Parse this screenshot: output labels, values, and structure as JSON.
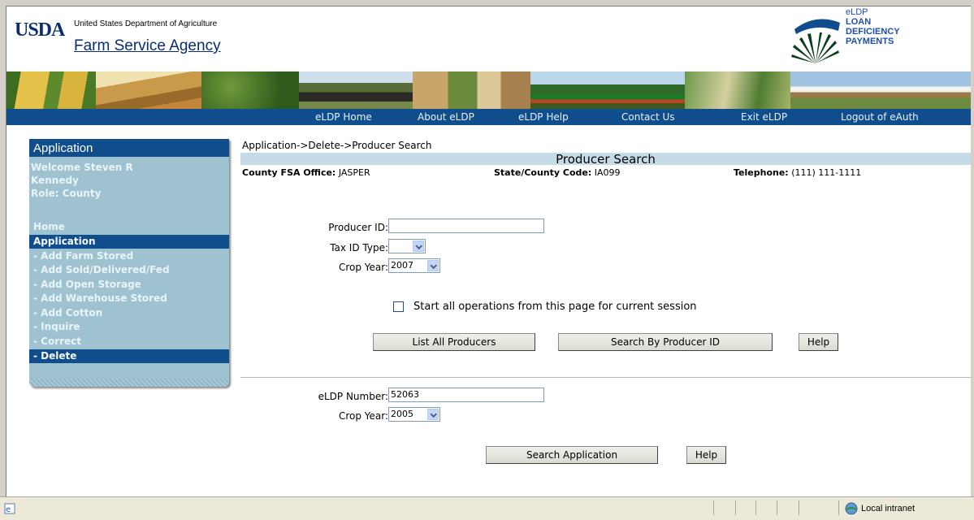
{
  "header": {
    "usda_logo": "USDA",
    "department": "United States Department of Agriculture",
    "agency": "Farm Service Agency",
    "eldp_logo": {
      "title": "eLDP",
      "line1": "LOAN",
      "line2": "DEFICIENCY",
      "line3": "PAYMENTS"
    }
  },
  "nav": {
    "items": [
      "eLDP Home",
      "About eLDP",
      "eLDP Help",
      "Contact Us",
      "Exit eLDP",
      "Logout of eAuth"
    ]
  },
  "sidebar": {
    "title": "Application",
    "welcome_line1": "Welcome  Steven R",
    "welcome_line2": "Kennedy",
    "role": "Role: County",
    "items": [
      {
        "label": "Home",
        "active": false
      },
      {
        "label": "Application",
        "active": true
      },
      {
        "label": " - Add Farm Stored",
        "active": false
      },
      {
        "label": " - Add Sold/Delivered/Fed",
        "active": false
      },
      {
        "label": " - Add Open Storage",
        "active": false
      },
      {
        "label": " - Add Warehouse Stored",
        "active": false
      },
      {
        "label": " - Add Cotton",
        "active": false
      },
      {
        "label": " - Inquire",
        "active": false
      },
      {
        "label": " - Correct",
        "active": false
      },
      {
        "label": " - Delete",
        "active": true
      }
    ]
  },
  "main": {
    "breadcrumb": "Application->Delete->Producer Search",
    "title": "Producer Search",
    "county_label": "County FSA Office:",
    "county_value": "JASPER",
    "state_label": "State/County Code:",
    "state_value": "IA099",
    "phone_label": "Telephone:",
    "phone_value": "(111) 111-1111",
    "producer_id_label": "Producer ID:",
    "producer_id_value": "",
    "tax_id_type_label": "Tax ID Type:",
    "tax_id_type_value": "",
    "crop_year_label": "Crop Year:",
    "crop_year_value": "2007",
    "start_checkbox_label": "Start all operations from this page for current session",
    "start_checkbox_checked": false,
    "btn_list_all": "List All Producers",
    "btn_search_id": "Search By Producer ID",
    "btn_help1": "Help",
    "eldp_number_label": "eLDP Number:",
    "eldp_number_value": "52063",
    "crop_year2_label": "Crop Year:",
    "crop_year2_value": "2005",
    "btn_search_app": "Search Application",
    "btn_help2": "Help"
  },
  "statusbar": {
    "zone_text": "Local intranet"
  },
  "colors": {
    "nav_bg": "#0f4d8c",
    "sidebar_bg": "#9ec2cf",
    "title_bar_bg": "#c6dbe8"
  }
}
